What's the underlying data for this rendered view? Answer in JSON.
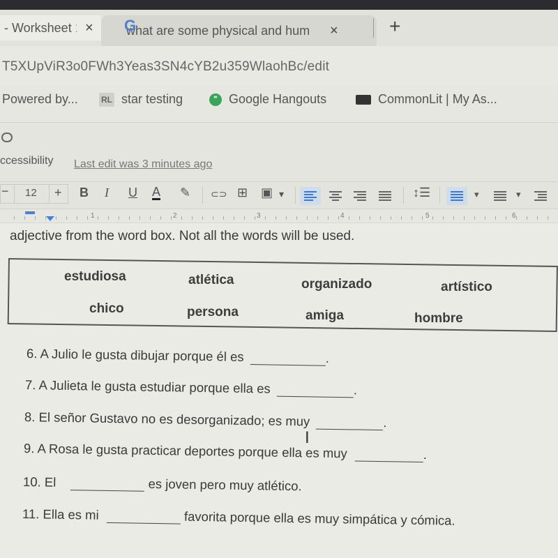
{
  "browser": {
    "tabs": [
      {
        "label": "- Worksheet 1",
        "active": true,
        "close_icon": "×"
      },
      {
        "label": "what are some physical and hum",
        "active": false,
        "favicon": "G",
        "close_icon": "×"
      }
    ],
    "new_tab_icon": "+",
    "url": "T5XUpViR3o0FWh3Yeas3SN4cYB2u359WlaohBc/edit",
    "bookmarks": [
      {
        "label": "Powered by...",
        "icon": ""
      },
      {
        "label": "star testing",
        "icon": "RL"
      },
      {
        "label": "Google Hangouts",
        "icon": "hangouts-icon"
      },
      {
        "label": "CommonLit | My As...",
        "icon": "book-icon"
      }
    ]
  },
  "docs": {
    "menu_accessibility": "ccessibility",
    "last_edit": "Last edit was 3 minutes ago",
    "toolbar": {
      "font_size": "12",
      "minus": "−",
      "plus": "+",
      "bold": "B",
      "italic": "I",
      "underline": "U",
      "text_color": "A",
      "highlight_icon": "✎",
      "link_icon": "⊂⊃",
      "comment_icon": "⊞",
      "image_icon": "▣",
      "dropdown": "▾"
    },
    "ruler_numbers": [
      "1",
      "2",
      "3",
      "4",
      "5",
      "6"
    ]
  },
  "worksheet": {
    "instruction": "adjective from the word box.  Not all the words will be used.",
    "word_box": [
      [
        "estudiosa",
        "atlética",
        "organizado",
        "artístico"
      ],
      [
        "chico",
        "persona",
        "amiga",
        "hombre"
      ]
    ],
    "questions": [
      {
        "num": "6.",
        "before": "A Julio le gusta dibujar porque él es",
        "after": "."
      },
      {
        "num": "7.",
        "before": "A Julieta le gusta estudiar porque ella es",
        "after": "."
      },
      {
        "num": "8.",
        "before": "El señor Gustavo no es desorganizado; es muy",
        "after": "."
      },
      {
        "num": "9.",
        "before": "A Rosa le gusta practicar deportes porque ella es muy",
        "after": "."
      },
      {
        "num": "10.",
        "before": "El",
        "after": "es joven pero muy atlético."
      },
      {
        "num": "11.",
        "before": "Ella es mi",
        "after": "favorita porque ella es muy simpática y cómica."
      }
    ]
  }
}
